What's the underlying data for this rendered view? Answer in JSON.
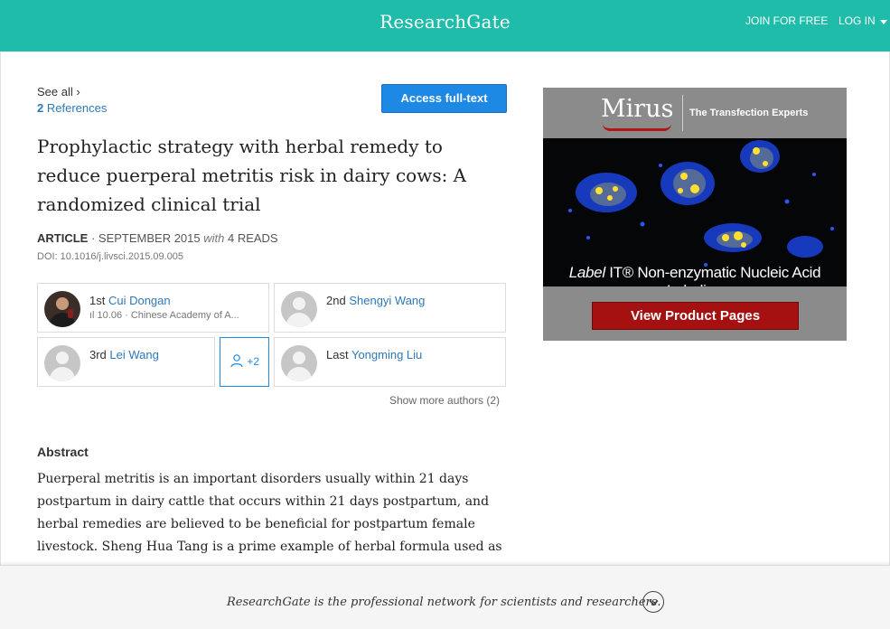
{
  "header": {
    "brand": "ResearchGate",
    "join_label": "JOIN FOR FREE",
    "login_label": "LOG IN"
  },
  "refs": {
    "see_all": "See all ›",
    "count": "2",
    "label": "References"
  },
  "access_button": "Access full-text",
  "article": {
    "title": "Prophylactic strategy with herbal remedy to reduce puerperal metritis risk in dairy cows: A randomized clinical trial",
    "type": "ARTICLE",
    "date": " · SEPTEMBER 2015 ",
    "with": "with",
    "reads": " 4 READS",
    "doi": "DOI: 10.1016/j.livsci.2015.09.005"
  },
  "authors": [
    {
      "position": "1st",
      "name": "Cui Dongan",
      "sub": "ıl 10.06 · Chinese Academy of A..."
    },
    {
      "position": "2nd",
      "name": "Shengyi Wang",
      "sub": ""
    },
    {
      "position": "3rd",
      "name": "Lei Wang",
      "sub": ""
    },
    {
      "position": "Last",
      "name": "Yongming Liu",
      "sub": ""
    }
  ],
  "more_authors": "+2",
  "show_more_authors": "Show more authors (2)",
  "abstract": {
    "heading": "Abstract",
    "text": "Puerperal metritis is an important disorders usually within 21 days postpartum in dairy cattle that occurs within 21 days postpartum, and herbal remedies are believed to be beneficial for postpartum female livestock. Sheng Hua Tang is a prime example of herbal formula used as a"
  },
  "ad": {
    "logo": "Mirus",
    "tagline": "The Transfection Experts",
    "caption_italic": "Label",
    "caption_rest": " IT® Non-enzymatic Nucleic Acid Labeling",
    "button": "View Product Pages",
    "colors": {
      "background": "#8b8b8b",
      "button": "#a51010"
    }
  },
  "footer": {
    "text": "ResearchGate is the professional network for scientists and researchers."
  },
  "colors": {
    "brand": "#1fbcaa",
    "link": "#2f78b7",
    "primary_button": "#1e88e5"
  }
}
